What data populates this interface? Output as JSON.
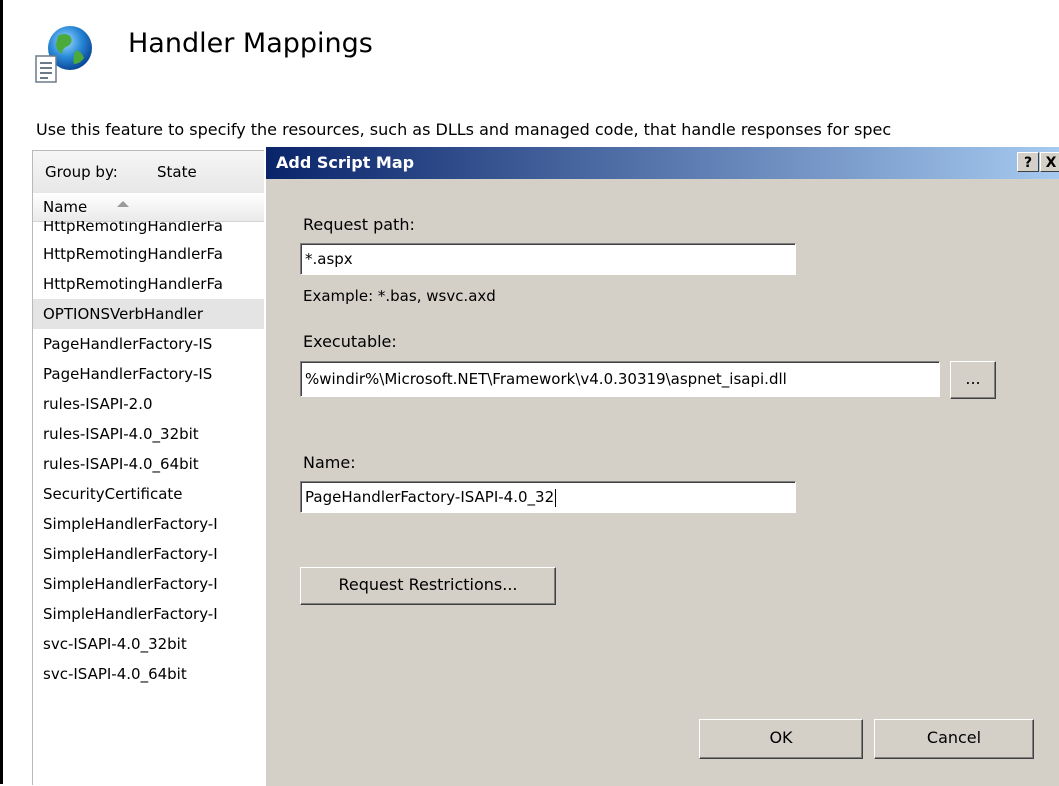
{
  "header": {
    "title": "Handler Mappings",
    "description": "Use this feature to specify the resources, such as DLLs and managed code, that handle responses for spec"
  },
  "list": {
    "group_by_label": "Group by:",
    "group_by_value": "State",
    "column_name": "Name",
    "partial_top_item": "HttpRemotingHandlerFa",
    "items": [
      "HttpRemotingHandlerFa",
      "HttpRemotingHandlerFa",
      "OPTIONSVerbHandler",
      "PageHandlerFactory-IS",
      "PageHandlerFactory-IS",
      "rules-ISAPI-2.0",
      "rules-ISAPI-4.0_32bit",
      "rules-ISAPI-4.0_64bit",
      "SecurityCertificate",
      "SimpleHandlerFactory-I",
      "SimpleHandlerFactory-I",
      "SimpleHandlerFactory-I",
      "SimpleHandlerFactory-I",
      "svc-ISAPI-4.0_32bit",
      "svc-ISAPI-4.0_64bit"
    ],
    "selected_index": 2
  },
  "dialog": {
    "title": "Add Script Map",
    "help_label": "?",
    "close_label": "X",
    "request_path_label": "Request path:",
    "request_path_value": "*.aspx",
    "example_text": "Example: *.bas, wsvc.axd",
    "executable_label": "Executable:",
    "executable_value": "%windir%\\Microsoft.NET\\Framework\\v4.0.30319\\aspnet_isapi.dll",
    "browse_label": "...",
    "name_label": "Name:",
    "name_value": "PageHandlerFactory-ISAPI-4.0_32",
    "request_restrictions_label": "Request Restrictions...",
    "ok_label": "OK",
    "cancel_label": "Cancel"
  },
  "colors": {
    "titlebar_start": "#0a246a",
    "titlebar_end": "#a6caf0",
    "dialog_bg": "#d4d0c8",
    "selected_row": "#e4e4e4"
  },
  "icons": {
    "feature": "globe-document-icon",
    "sort": "sort-ascending-icon"
  }
}
